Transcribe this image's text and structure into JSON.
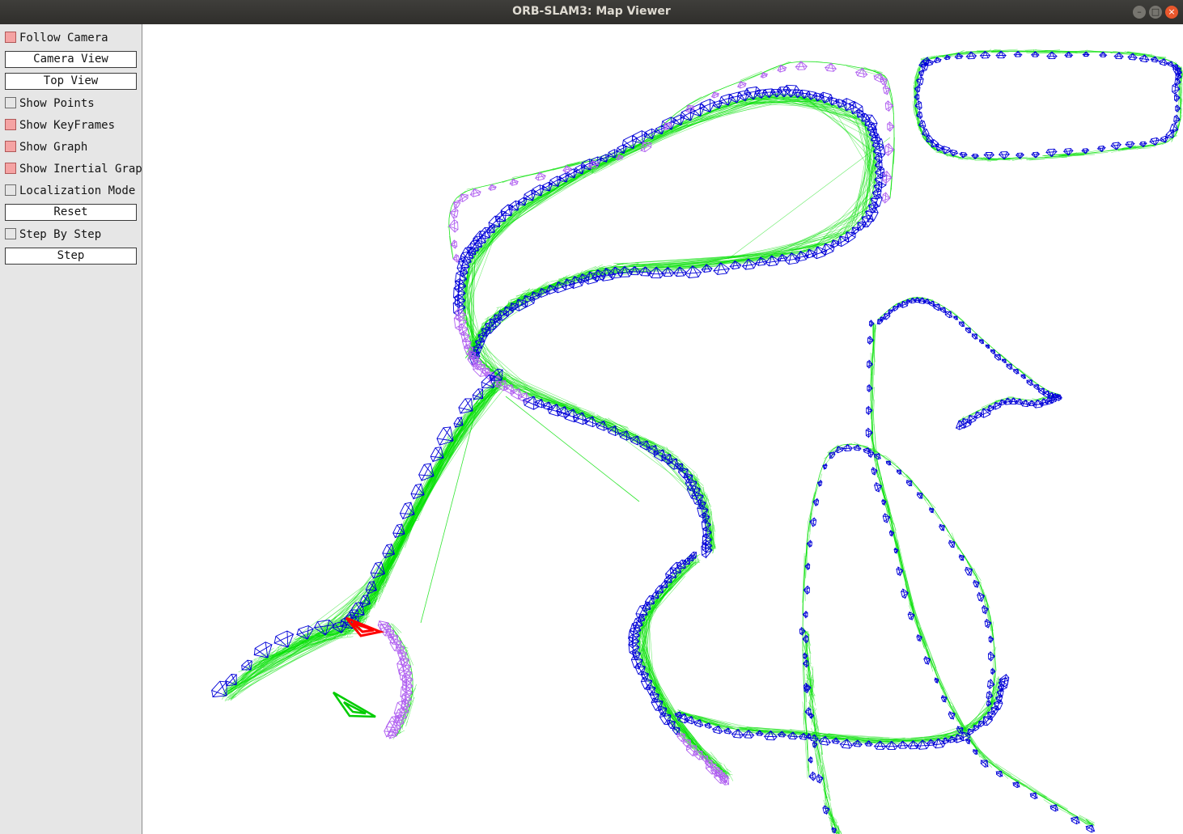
{
  "window": {
    "title": "ORB-SLAM3: Map Viewer",
    "minimize_glyph": "–",
    "maximize_glyph": "□",
    "close_glyph": "×"
  },
  "panel": {
    "follow_camera": {
      "label": "Follow Camera",
      "checked": true
    },
    "camera_view": {
      "label": "Camera View"
    },
    "top_view": {
      "label": "Top View"
    },
    "show_points": {
      "label": "Show Points",
      "checked": false
    },
    "show_keyframes": {
      "label": "Show KeyFrames",
      "checked": true
    },
    "show_graph": {
      "label": "Show Graph",
      "checked": true
    },
    "show_inertial_graph": {
      "label": "Show Inertial Graph",
      "checked": true
    },
    "localization_mode": {
      "label": "Localization Mode",
      "checked": false
    },
    "reset": {
      "label": "Reset"
    },
    "step_by_step": {
      "label": "Step By Step",
      "checked": false
    },
    "step": {
      "label": "Step"
    }
  },
  "viewer": {
    "colors": {
      "keyframe": "#0000d8",
      "graph_edge": "#00e000",
      "inertial_keyframe": "#b060f0",
      "current_camera": "#ff0000",
      "origin_camera": "#00cc00"
    }
  }
}
